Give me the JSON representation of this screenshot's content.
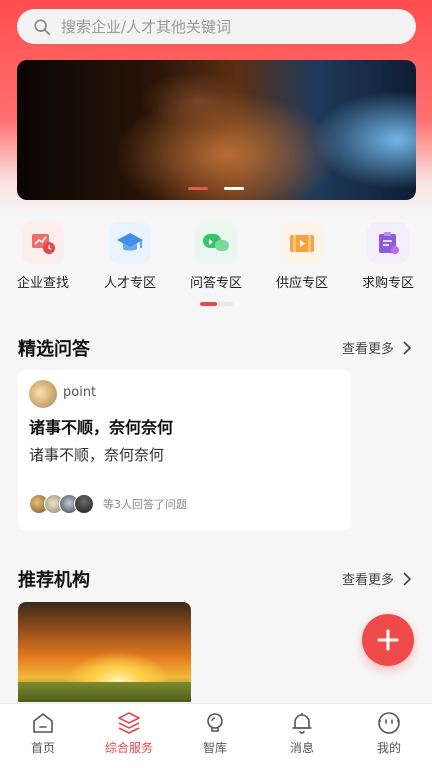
{
  "search": {
    "placeholder": "搜索企业/人才其他关键词",
    "icon": "search-icon"
  },
  "banner": {
    "image": "astronaut-helmet-closeup",
    "dots": 2,
    "active_dot": 1
  },
  "quick_menu": [
    {
      "label": "企业查找",
      "icon": "enterprise-search-icon",
      "color": "#f26b6b"
    },
    {
      "label": "人才专区",
      "icon": "graduation-cap-icon",
      "color": "#3f8fe6"
    },
    {
      "label": "问答专区",
      "icon": "chat-bubbles-icon",
      "color": "#37c46a"
    },
    {
      "label": "供应专区",
      "icon": "video-icon",
      "color": "#f3a43c"
    },
    {
      "label": "求购专区",
      "icon": "clipboard-icon",
      "color": "#8b5be0"
    }
  ],
  "featured_qa": {
    "title": "精选问答",
    "more": "查看更多",
    "card": {
      "user": "point",
      "question_title": "诸事不顺，奈何奈何",
      "question_body": "诸事不顺，奈何奈何",
      "answer_summary": "等3人回答了问题"
    }
  },
  "recommended": {
    "title": "推荐机构",
    "more": "查看更多",
    "card_image": "sunset-landscape"
  },
  "fab": {
    "icon": "plus-icon"
  },
  "tabbar": [
    {
      "label": "首页",
      "icon": "home-icon",
      "active": false
    },
    {
      "label": "综合服务",
      "icon": "layers-icon",
      "active": true
    },
    {
      "label": "智库",
      "icon": "lightbulb-icon",
      "active": false
    },
    {
      "label": "消息",
      "icon": "bell-icon",
      "active": false
    },
    {
      "label": "我的",
      "icon": "smiley-icon",
      "active": false
    }
  ],
  "colors": {
    "accent": "#e8464d",
    "header": "#ff4d4d"
  }
}
